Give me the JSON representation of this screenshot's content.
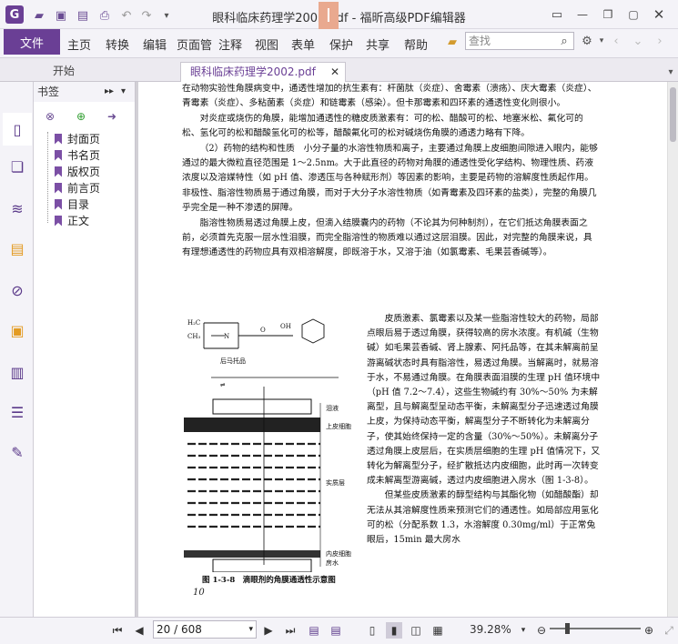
{
  "window": {
    "title": "眼科临床药理学2002.pdf - 福昕高级PDF编辑器",
    "badge": "I"
  },
  "menu": {
    "file": "文件",
    "items": [
      "主页",
      "转换",
      "编辑",
      "页面管",
      "注释",
      "视图",
      "表单",
      "保护",
      "共享",
      "帮助"
    ],
    "search_placeholder": "查找"
  },
  "tabs": [
    {
      "label": "开始",
      "active": false
    },
    {
      "label": "眼科临床药理学2002.pdf",
      "active": true
    }
  ],
  "bookmarks": {
    "title": "书签",
    "items": [
      "封面页",
      "书名页",
      "版权页",
      "前言页",
      "目录",
      "正文"
    ]
  },
  "document": {
    "paragraphs": [
      "在动物实验性角膜病变中，通透性增加的抗生素有：杆菌肽（炎症）、舍霉素（溃疡）、庆大霉素（炎症）、青霉素（炎症）、多粘菌素（炎症）和链霉素（感染）。但卡那霉素和四环素的通透性变化则很小。",
      "对炎症或烧伤的角膜，能增加通透性的糖皮质激素有：可的松、醋酸可的松、地塞米松、氟化可的松、氢化可的松和醋酸氢化可的松等，醋酸氟化可的松对碱烧伤角膜的通透力略有下降。",
      "（2）药物的结构和性质　小分子量的水溶性物质和离子，主要通过角膜上皮细胞间隙进入眼内，能够通过的最大微粒直径范围是 1～2.5nm。大于此直径的药物对角膜的通透性受化学结构、物理性质、药液浓度以及溶媒特性（如 pH 值、渗透压与各种赋形剂）等因素的影响，主要是药物的溶解度性质起作用。非极性、脂溶性物质易于通过角膜，而对于大分子水溶性物质（如青霉素及四环素的盐类），完整的角膜几乎完全是一种不渗透的屏障。",
      "脂溶性物质易透过角膜上皮，但滴入结膜囊内的药物（不论其为何种制剂），在它们抵达角膜表面之前，必须首先克服一层水性泪膜，而完全脂溶性的物质难以通过这层泪膜。因此，对完整的角膜来说，具有理想通透性的药物应具有双相溶解度，即既溶于水，又溶于油（如氯霉素、毛果芸香碱等）。"
    ],
    "right_column": [
      "皮质激素、氯霉素以及某一些脂溶性较大的药物，局部点眼后易于透过角膜，获得较高的房水浓度。有机碱（生物碱）如毛果芸香碱、肾上腺素、阿托品等，在其未解离前呈游离碱状态时具有脂溶性，易透过角膜。当解离时，就易溶于水，不易通过角膜。在角膜表面泪膜的生理 pH 值环境中（pH 值 7.2～7.4），这些生物碱约有 30%～50% 为未解离型，且与解离型呈动态平衡，未解离型分子迅速透过角膜上皮，为保持动态平衡，解离型分子不断转化为未解离分子，使其始终保持一定的含量（30%～50%）。未解离分子透过角膜上皮层后，在实质层细胞的生理 pH 值情况下，又转化为解离型分子，经扩散抵达内皮细胞，此时再一次转变成未解离型游离碱，透过内皮细胞进入房水（图 1-3-8）。",
      "但某些皮质激素的醇型结构与其酯化物（如醋酸酯）却无法从其溶解度性质来预测它们的通透性。如局部应用氢化可的松（分配系数 1.3，水溶解度 0.30mg/ml）于正常兔眼后，15min 最大房水"
    ],
    "figure": {
      "compound_label": "后马托品",
      "layer_tear": "泪液",
      "layer_epithelium": "上皮细胞",
      "layer_stroma": "实质层",
      "layer_endothelium": "内皮细胞",
      "layer_aqueous": "房水",
      "caption": "图 1-3-8　滴眼剂的角膜通透性示意图"
    },
    "page_number": "10"
  },
  "status": {
    "page_display": "20 / 608",
    "zoom": "39.28%"
  }
}
